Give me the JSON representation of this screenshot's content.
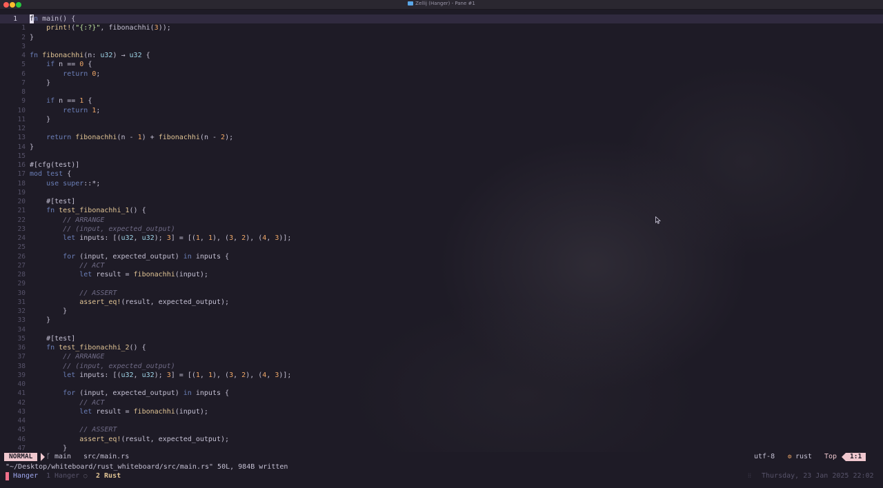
{
  "window": {
    "title": "Zellij (Hanger) - Pane #1"
  },
  "editor": {
    "lines": [
      {
        "n": "1",
        "current": true,
        "tokens": [
          [
            "cursor",
            "f"
          ],
          [
            "kw",
            "n"
          ],
          [
            "",
            " main() {"
          ]
        ]
      },
      {
        "n": "1",
        "tokens": [
          [
            "",
            "    "
          ],
          [
            "mac",
            "print!"
          ],
          [
            "",
            "("
          ],
          [
            "st",
            "\"{:?}\""
          ],
          [
            "",
            ", fibonachhi("
          ],
          [
            "nu",
            "3"
          ],
          [
            "",
            "));"
          ]
        ]
      },
      {
        "n": "2",
        "tokens": [
          [
            "",
            "}"
          ]
        ]
      },
      {
        "n": "3",
        "tokens": []
      },
      {
        "n": "4",
        "tokens": [
          [
            "kw",
            "fn "
          ],
          [
            "fnn",
            "fibonachhi"
          ],
          [
            "",
            "(n: "
          ],
          [
            "ty",
            "u32"
          ],
          [
            "",
            ") → "
          ],
          [
            "ty",
            "u32"
          ],
          [
            "",
            " {"
          ]
        ]
      },
      {
        "n": "5",
        "tokens": [
          [
            "",
            "    "
          ],
          [
            "kw",
            "if"
          ],
          [
            "",
            " n == "
          ],
          [
            "nu",
            "0"
          ],
          [
            "",
            " {"
          ]
        ]
      },
      {
        "n": "6",
        "tokens": [
          [
            "",
            "        "
          ],
          [
            "kw",
            "return "
          ],
          [
            "nu",
            "0"
          ],
          [
            "",
            ";"
          ]
        ]
      },
      {
        "n": "7",
        "tokens": [
          [
            "",
            "    }"
          ]
        ]
      },
      {
        "n": "8",
        "tokens": []
      },
      {
        "n": "9",
        "tokens": [
          [
            "",
            "    "
          ],
          [
            "kw",
            "if"
          ],
          [
            "",
            " n == "
          ],
          [
            "nu",
            "1"
          ],
          [
            "",
            " {"
          ]
        ]
      },
      {
        "n": "10",
        "tokens": [
          [
            "",
            "        "
          ],
          [
            "kw",
            "return "
          ],
          [
            "nu",
            "1"
          ],
          [
            "",
            ";"
          ]
        ]
      },
      {
        "n": "11",
        "tokens": [
          [
            "",
            "    }"
          ]
        ]
      },
      {
        "n": "12",
        "tokens": []
      },
      {
        "n": "13",
        "tokens": [
          [
            "",
            "    "
          ],
          [
            "kw",
            "return "
          ],
          [
            "fnn",
            "fibonachhi"
          ],
          [
            "",
            "(n - "
          ],
          [
            "nu",
            "1"
          ],
          [
            "",
            ") + "
          ],
          [
            "fnn",
            "fibonachhi"
          ],
          [
            "",
            "(n - "
          ],
          [
            "nu",
            "2"
          ],
          [
            "",
            ");"
          ]
        ]
      },
      {
        "n": "14",
        "tokens": [
          [
            "",
            "}"
          ]
        ]
      },
      {
        "n": "15",
        "tokens": []
      },
      {
        "n": "16",
        "tokens": [
          [
            "at",
            "#[cfg(test)]"
          ]
        ]
      },
      {
        "n": "17",
        "tokens": [
          [
            "kw",
            "mod "
          ],
          [
            "kw",
            "test"
          ],
          [
            "",
            " {"
          ]
        ]
      },
      {
        "n": "18",
        "tokens": [
          [
            "",
            "    "
          ],
          [
            "kw",
            "use super"
          ],
          [
            "",
            "::*;"
          ]
        ]
      },
      {
        "n": "19",
        "tokens": []
      },
      {
        "n": "20",
        "tokens": [
          [
            "",
            "    "
          ],
          [
            "at",
            "#[test]"
          ]
        ]
      },
      {
        "n": "21",
        "tokens": [
          [
            "",
            "    "
          ],
          [
            "kw",
            "fn "
          ],
          [
            "fnn",
            "test_fibonachhi_1"
          ],
          [
            "",
            "() {"
          ]
        ]
      },
      {
        "n": "22",
        "tokens": [
          [
            "",
            "        "
          ],
          [
            "cm",
            "// ARRANGE"
          ]
        ]
      },
      {
        "n": "23",
        "tokens": [
          [
            "",
            "        "
          ],
          [
            "cm",
            "// (input, expected_output)"
          ]
        ]
      },
      {
        "n": "24",
        "tokens": [
          [
            "",
            "        "
          ],
          [
            "kw",
            "let "
          ],
          [
            "",
            "inputs: [("
          ],
          [
            "ty",
            "u32"
          ],
          [
            "",
            ", "
          ],
          [
            "ty",
            "u32"
          ],
          [
            "",
            "); "
          ],
          [
            "nu",
            "3"
          ],
          [
            "",
            "] = [("
          ],
          [
            "nu",
            "1"
          ],
          [
            "",
            ", "
          ],
          [
            "nu",
            "1"
          ],
          [
            "",
            "), ("
          ],
          [
            "nu",
            "3"
          ],
          [
            "",
            ", "
          ],
          [
            "nu",
            "2"
          ],
          [
            "",
            "), ("
          ],
          [
            "nu",
            "4"
          ],
          [
            "",
            ", "
          ],
          [
            "nu",
            "3"
          ],
          [
            "",
            ")];"
          ]
        ]
      },
      {
        "n": "25",
        "tokens": []
      },
      {
        "n": "26",
        "tokens": [
          [
            "",
            "        "
          ],
          [
            "kw",
            "for "
          ],
          [
            "",
            "(input, expected_output) "
          ],
          [
            "kw",
            "in "
          ],
          [
            "",
            "inputs {"
          ]
        ]
      },
      {
        "n": "27",
        "tokens": [
          [
            "",
            "            "
          ],
          [
            "cm",
            "// ACT"
          ]
        ]
      },
      {
        "n": "28",
        "tokens": [
          [
            "",
            "            "
          ],
          [
            "kw",
            "let "
          ],
          [
            "",
            "result = "
          ],
          [
            "fnn",
            "fibonachhi"
          ],
          [
            "",
            "(input);"
          ]
        ]
      },
      {
        "n": "29",
        "tokens": []
      },
      {
        "n": "30",
        "tokens": [
          [
            "",
            "            "
          ],
          [
            "cm",
            "// ASSERT"
          ]
        ]
      },
      {
        "n": "31",
        "tokens": [
          [
            "",
            "            "
          ],
          [
            "mac",
            "assert_eq!"
          ],
          [
            "",
            "(result, expected_output);"
          ]
        ]
      },
      {
        "n": "32",
        "tokens": [
          [
            "",
            "        }"
          ]
        ]
      },
      {
        "n": "33",
        "tokens": [
          [
            "",
            "    }"
          ]
        ]
      },
      {
        "n": "34",
        "tokens": []
      },
      {
        "n": "35",
        "tokens": [
          [
            "",
            "    "
          ],
          [
            "at",
            "#[test]"
          ]
        ]
      },
      {
        "n": "36",
        "tokens": [
          [
            "",
            "    "
          ],
          [
            "kw",
            "fn "
          ],
          [
            "fnn",
            "test_fibonachhi_2"
          ],
          [
            "",
            "() {"
          ]
        ]
      },
      {
        "n": "37",
        "tokens": [
          [
            "",
            "        "
          ],
          [
            "cm",
            "// ARRANGE"
          ]
        ]
      },
      {
        "n": "38",
        "tokens": [
          [
            "",
            "        "
          ],
          [
            "cm",
            "// (input, expected_output)"
          ]
        ]
      },
      {
        "n": "39",
        "tokens": [
          [
            "",
            "        "
          ],
          [
            "kw",
            "let "
          ],
          [
            "",
            "inputs: [("
          ],
          [
            "ty",
            "u32"
          ],
          [
            "",
            ", "
          ],
          [
            "ty",
            "u32"
          ],
          [
            "",
            "); "
          ],
          [
            "nu",
            "3"
          ],
          [
            "",
            "] = [("
          ],
          [
            "nu",
            "1"
          ],
          [
            "",
            ", "
          ],
          [
            "nu",
            "1"
          ],
          [
            "",
            "), ("
          ],
          [
            "nu",
            "3"
          ],
          [
            "",
            ", "
          ],
          [
            "nu",
            "2"
          ],
          [
            "",
            "), ("
          ],
          [
            "nu",
            "4"
          ],
          [
            "",
            ", "
          ],
          [
            "nu",
            "3"
          ],
          [
            "",
            ")];"
          ]
        ]
      },
      {
        "n": "40",
        "tokens": []
      },
      {
        "n": "41",
        "tokens": [
          [
            "",
            "        "
          ],
          [
            "kw",
            "for "
          ],
          [
            "",
            "(input, expected_output) "
          ],
          [
            "kw",
            "in "
          ],
          [
            "",
            "inputs {"
          ]
        ]
      },
      {
        "n": "42",
        "tokens": [
          [
            "",
            "            "
          ],
          [
            "cm",
            "// ACT"
          ]
        ]
      },
      {
        "n": "43",
        "tokens": [
          [
            "",
            "            "
          ],
          [
            "kw",
            "let "
          ],
          [
            "",
            "result = "
          ],
          [
            "fnn",
            "fibonachhi"
          ],
          [
            "",
            "(input);"
          ]
        ]
      },
      {
        "n": "44",
        "tokens": []
      },
      {
        "n": "45",
        "tokens": [
          [
            "",
            "            "
          ],
          [
            "cm",
            "// ASSERT"
          ]
        ]
      },
      {
        "n": "46",
        "tokens": [
          [
            "",
            "            "
          ],
          [
            "mac",
            "assert_eq!"
          ],
          [
            "",
            "(result, expected_output);"
          ]
        ]
      },
      {
        "n": "47",
        "tokens": [
          [
            "",
            "        }"
          ]
        ]
      }
    ]
  },
  "statusline": {
    "mode": "NORMAL",
    "branch_icon": "git-branch-icon",
    "branch": "main",
    "file": "src/main.rs",
    "encoding": "utf-8",
    "filetype_icon": "rust-icon",
    "filetype": "rust",
    "scroll": "Top",
    "position": "1:1"
  },
  "message": "\"~/Desktop/whiteboard/rust_whiteboard/src/main.rs\" 50L, 984B written",
  "zellij": {
    "session": "Hanger",
    "tabs": [
      {
        "label": "1 Hanger",
        "active": false
      },
      {
        "label": "2 Rust",
        "active": true
      }
    ],
    "clock": "Thursday, 23 Jan 2025 22:02"
  },
  "colors": {
    "background": "#1e1b26",
    "mode_badge": "#f0c8cf",
    "keyword": "#6b7fb8",
    "function": "#e2c595",
    "number": "#f0a868",
    "string": "#bde0a0",
    "type": "#9ed3e6"
  }
}
